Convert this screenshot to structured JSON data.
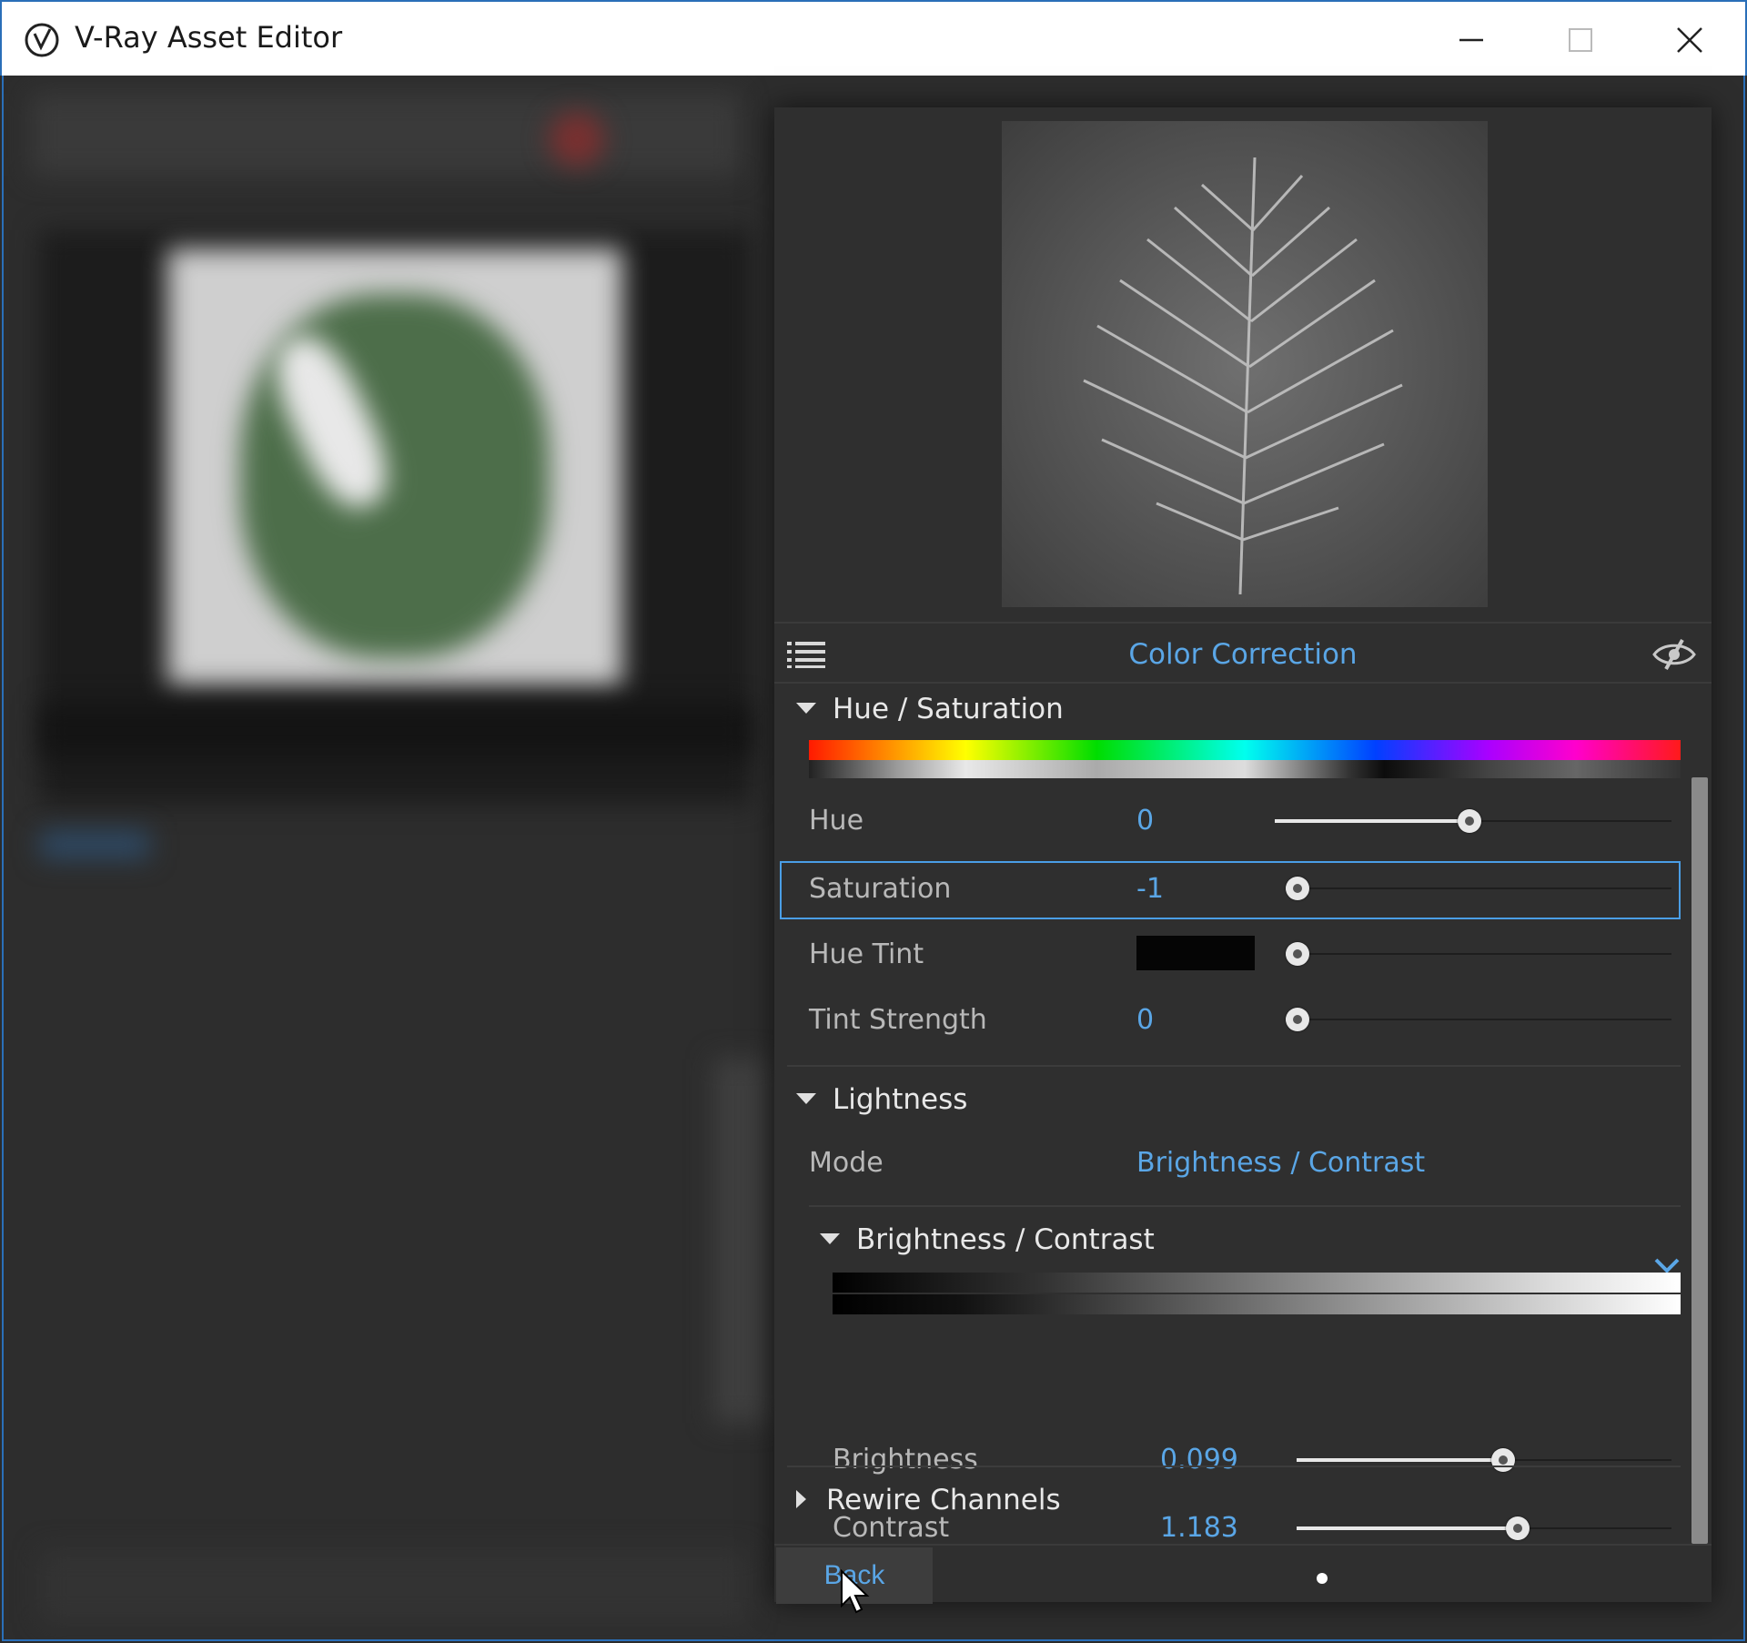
{
  "window": {
    "title": "V-Ray Asset Editor",
    "minimize_icon": "minimize-icon",
    "maximize_icon": "maximize-icon",
    "close_icon": "close-icon"
  },
  "panel": {
    "header_title": "Color Correction",
    "hue_saturation": {
      "section_label": "Hue / Saturation",
      "hue": {
        "label": "Hue",
        "value": "0",
        "slider_fraction": 0.49
      },
      "saturation": {
        "label": "Saturation",
        "value": "-1",
        "slider_fraction": 0.03
      },
      "hue_tint": {
        "label": "Hue Tint",
        "color": "#050505",
        "slider_fraction": 0.03
      },
      "tint_strength": {
        "label": "Tint Strength",
        "value": "0",
        "slider_fraction": 0.03
      }
    },
    "lightness": {
      "section_label": "Lightness",
      "mode_label": "Mode",
      "mode_value": "Brightness / Contrast",
      "brightness_contrast": {
        "section_label": "Brightness / Contrast",
        "brightness": {
          "label": "Brightness",
          "value": "0.099",
          "slider_fraction": 0.55
        },
        "contrast": {
          "label": "Contrast",
          "value": "1.183",
          "slider_fraction": 0.59
        }
      }
    },
    "rewire_channels": {
      "section_label": "Rewire Channels"
    },
    "footer": {
      "back_label": "Back"
    }
  },
  "colors": {
    "accent": "#5aa6e6",
    "panel_bg": "#2f2f2f",
    "selection_border": "#4a9ee6"
  }
}
